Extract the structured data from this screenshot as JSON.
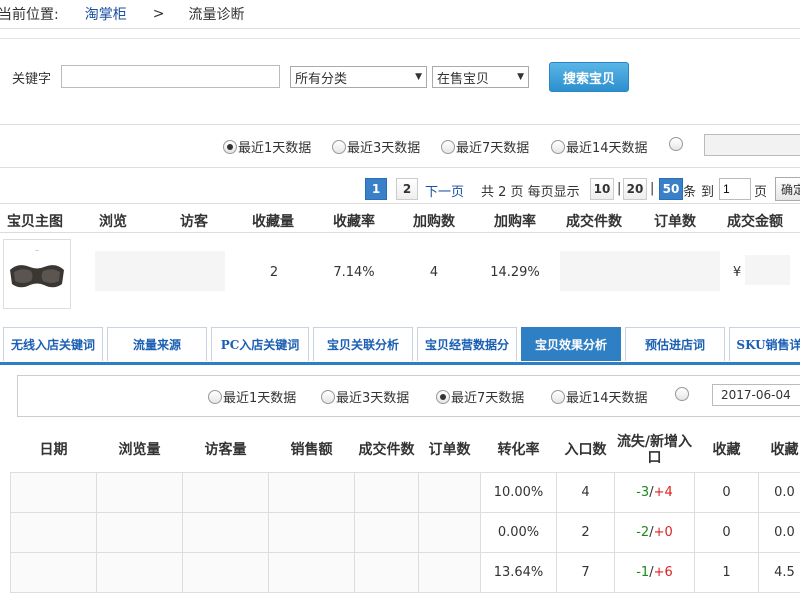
{
  "breadcrumb": {
    "current_label": "当前位置:",
    "link": "淘掌柜",
    "separator": ">",
    "page": "流量诊断"
  },
  "search": {
    "keyword_label": "关键字",
    "keyword_value": "",
    "category_select": "所有分类",
    "status_select": "在售宝贝",
    "button": "搜索宝贝"
  },
  "range_top": {
    "options": [
      "最近1天数据",
      "最近3天数据",
      "最近7天数据",
      "最近14天数据"
    ],
    "selected_index": 0
  },
  "pager": {
    "pages": [
      "1",
      "2"
    ],
    "current_page": "1",
    "next": "下一页",
    "summary": "共 2 页 每页显示",
    "sizes": [
      "10",
      "20",
      "50"
    ],
    "current_size": "50",
    "sep": "|",
    "unit": "条",
    "goto": "到",
    "goto_value": "1",
    "page_unit": "页",
    "confirm": "确定"
  },
  "product_table": {
    "headers": [
      "宝贝主图",
      "浏览",
      "访客",
      "收藏量",
      "收藏率",
      "加购数",
      "加购率",
      "成交件数",
      "订单数",
      "成交金额"
    ],
    "row": {
      "favorites": "2",
      "fav_rate": "7.14%",
      "cart": "4",
      "cart_rate": "14.29%",
      "amount": "¥"
    }
  },
  "tabs": [
    "无线入店关键词",
    "流量来源",
    "PC入店关键词",
    "宝贝关联分析",
    "宝贝经营数据分",
    "宝贝效果分析",
    "预估进店词",
    "SKU销售详"
  ],
  "active_tab": "宝贝效果分析",
  "range_bottom": {
    "options": [
      "最近1天数据",
      "最近3天数据",
      "最近7天数据",
      "最近14天数据"
    ],
    "selected_index": 2,
    "date": "2017-06-04"
  },
  "detail_table": {
    "headers": [
      "日期",
      "浏览量",
      "访客量",
      "销售额",
      "成交件数",
      "订单数",
      "转化率",
      "入口数",
      "流失/新增入口",
      "收藏",
      "收藏"
    ],
    "rows": [
      {
        "conv": "10.00%",
        "entries": "4",
        "lost": "-3",
        "slash": "/",
        "added": "+4",
        "fav": "0",
        "fav_rate": "0.0"
      },
      {
        "conv": "0.00%",
        "entries": "2",
        "lost": "-2",
        "slash": "/",
        "added": "+0",
        "fav": "0",
        "fav_rate": "0.0"
      },
      {
        "conv": "13.64%",
        "entries": "7",
        "lost": "-1",
        "slash": "/",
        "added": "+6",
        "fav": "1",
        "fav_rate": "4.5"
      }
    ]
  },
  "colors": {
    "link": "#1a4fa0",
    "accent": "#2f7fc4",
    "button": "#3a9ad9",
    "negative": "#1a8a1a",
    "positive": "#e02020"
  }
}
